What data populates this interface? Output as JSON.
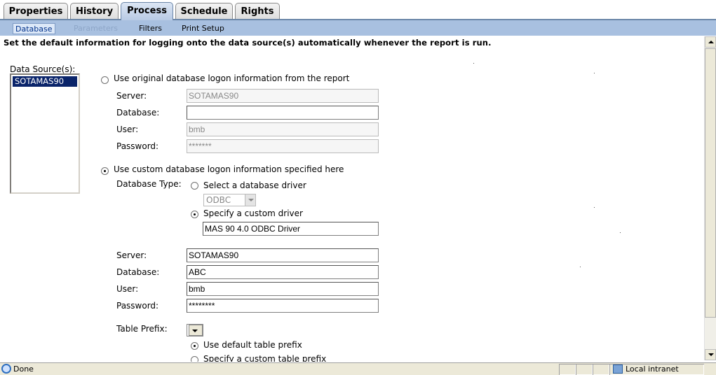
{
  "tabs": [
    {
      "label": "Properties"
    },
    {
      "label": "History"
    },
    {
      "label": "Process"
    },
    {
      "label": "Schedule"
    },
    {
      "label": "Rights"
    }
  ],
  "active_tab": "Process",
  "subnav": [
    {
      "label": "Database",
      "state": "active"
    },
    {
      "label": "Parameters",
      "state": "disabled"
    },
    {
      "label": "Filters",
      "state": "normal"
    },
    {
      "label": "Print Setup",
      "state": "normal"
    }
  ],
  "instruction": "Set the default information for logging onto the data source(s) automatically whenever the report is run.",
  "data_sources": {
    "label": "Data Source(s):",
    "items": [
      "SOTAMAS90"
    ],
    "selected": "SOTAMAS90"
  },
  "original": {
    "radio_label": "Use original database logon information from the report",
    "checked": false,
    "server_label": "Server:",
    "server_value": "SOTAMAS90",
    "database_label": "Database:",
    "database_value": "",
    "user_label": "User:",
    "user_value": "bmb",
    "password_label": "Password:",
    "password_value": "*******"
  },
  "custom": {
    "radio_label": "Use custom database logon information specified here",
    "checked": true,
    "db_type_label": "Database Type:",
    "select_driver_label": "Select a database driver",
    "select_driver_checked": false,
    "driver_select_value": "ODBC",
    "custom_driver_label": "Specify a custom driver",
    "custom_driver_checked": true,
    "custom_driver_value": "MAS 90 4.0 ODBC Driver",
    "server_label": "Server:",
    "server_value": "SOTAMAS90",
    "database_label": "Database:",
    "database_value": "ABC",
    "user_label": "User:",
    "user_value": "bmb",
    "password_label": "Password:",
    "password_value": "********"
  },
  "table_prefix": {
    "label": "Table Prefix:",
    "default_label": "Use default table prefix",
    "default_checked": true,
    "custom_label": "Specify a custom table prefix",
    "custom_checked": false
  },
  "statusbar": {
    "status": "Done",
    "zone": "Local intranet"
  },
  "icons": [
    "ie-page-icon",
    "local-intranet-icon",
    "scroll-up-icon",
    "scroll-down-icon",
    "dropdown-arrow-icon"
  ]
}
